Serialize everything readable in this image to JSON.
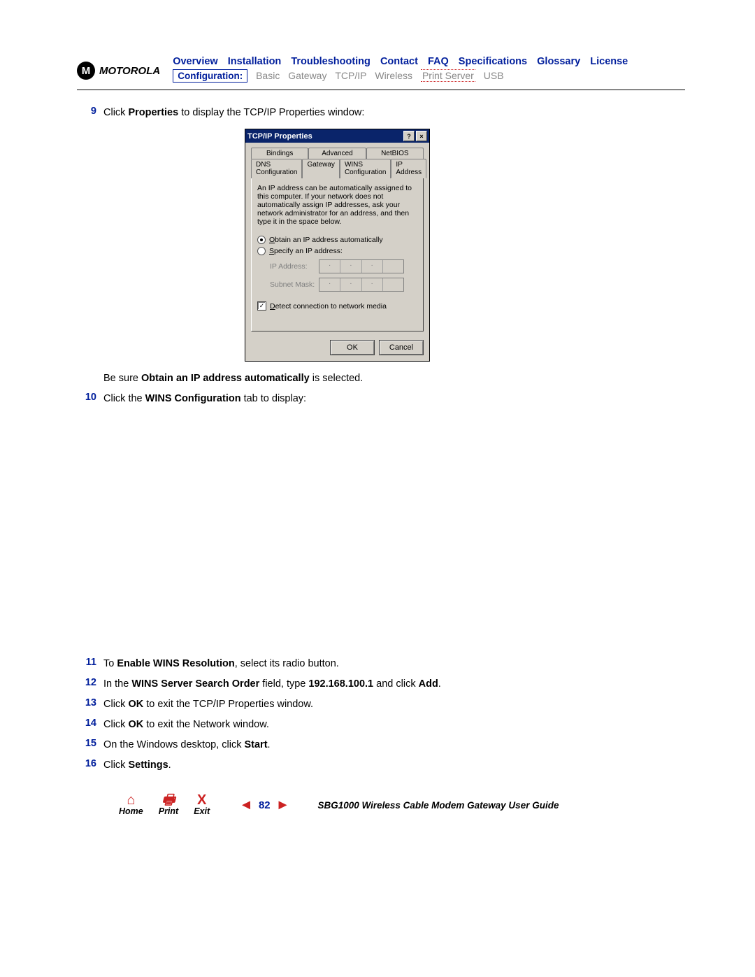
{
  "logo_text": "MOTOROLA",
  "top_nav": {
    "overview": "Overview",
    "installation": "Installation",
    "troubleshooting": "Troubleshooting",
    "contact": "Contact",
    "faq": "FAQ",
    "specifications": "Specifications",
    "glossary": "Glossary",
    "license": "License"
  },
  "sub_nav": {
    "config_label": "Configuration:",
    "basic": "Basic",
    "gateway": "Gateway",
    "tcpip": "TCP/IP",
    "wireless": "Wireless",
    "print_server": "Print Server",
    "usb": "USB"
  },
  "steps": {
    "s9": {
      "num": "9",
      "pre": "Click ",
      "bold": "Properties",
      "post": " to display the TCP/IP Properties window:"
    },
    "s9b": {
      "pre": "Be sure ",
      "bold": "Obtain an IP address automatically",
      "post": " is selected."
    },
    "s10": {
      "num": "10",
      "pre": "Click the ",
      "bold": "WINS Configuration",
      "post": " tab to display:"
    },
    "s11": {
      "num": "11",
      "pre": "To ",
      "bold": "Enable WINS Resolution",
      "post": ", select its radio button."
    },
    "s12": {
      "num": "12",
      "pre": "In the ",
      "bold1": "WINS Server Search Order",
      "mid": " field, type ",
      "bold2": "192.168.100.1",
      "mid2": " and click ",
      "bold3": "Add",
      "post": "."
    },
    "s13": {
      "num": "13",
      "pre": "Click ",
      "bold": "OK",
      "post": " to exit the TCP/IP Properties window."
    },
    "s14": {
      "num": "14",
      "pre": "Click ",
      "bold": "OK",
      "post": " to exit the Network window."
    },
    "s15": {
      "num": "15",
      "pre": "On the Windows desktop, click ",
      "bold": "Start",
      "post": "."
    },
    "s16": {
      "num": "16",
      "pre": "Click ",
      "bold": "Settings",
      "post": "."
    }
  },
  "dialog": {
    "title": "TCP/IP Properties",
    "help_btn": "?",
    "close_btn": "×",
    "tabs_row1": {
      "bindings": "Bindings",
      "advanced": "Advanced",
      "netbios": "NetBIOS"
    },
    "tabs_row2": {
      "dns": "DNS Configuration",
      "gateway": "Gateway",
      "wins": "WINS Configuration",
      "ip": "IP Address"
    },
    "blurb": "An IP address can be automatically assigned to this computer. If your network does not automatically assign IP addresses, ask your network administrator for an address, and then type it in the space below.",
    "radio_obtain_pre": "O",
    "radio_obtain_rest": "btain an IP address automatically",
    "radio_specify_pre": "S",
    "radio_specify_rest": "pecify an IP address:",
    "ip_label": "IP Address:",
    "subnet_label": "Subnet Mask:",
    "detect_pre": "D",
    "detect_rest": "etect connection to network media",
    "ok": "OK",
    "cancel": "Cancel"
  },
  "footer": {
    "home": "Home",
    "print": "Print",
    "exit": "Exit",
    "exit_icon": "X",
    "page": "82",
    "guide": "SBG1000 Wireless Cable Modem Gateway User Guide"
  }
}
